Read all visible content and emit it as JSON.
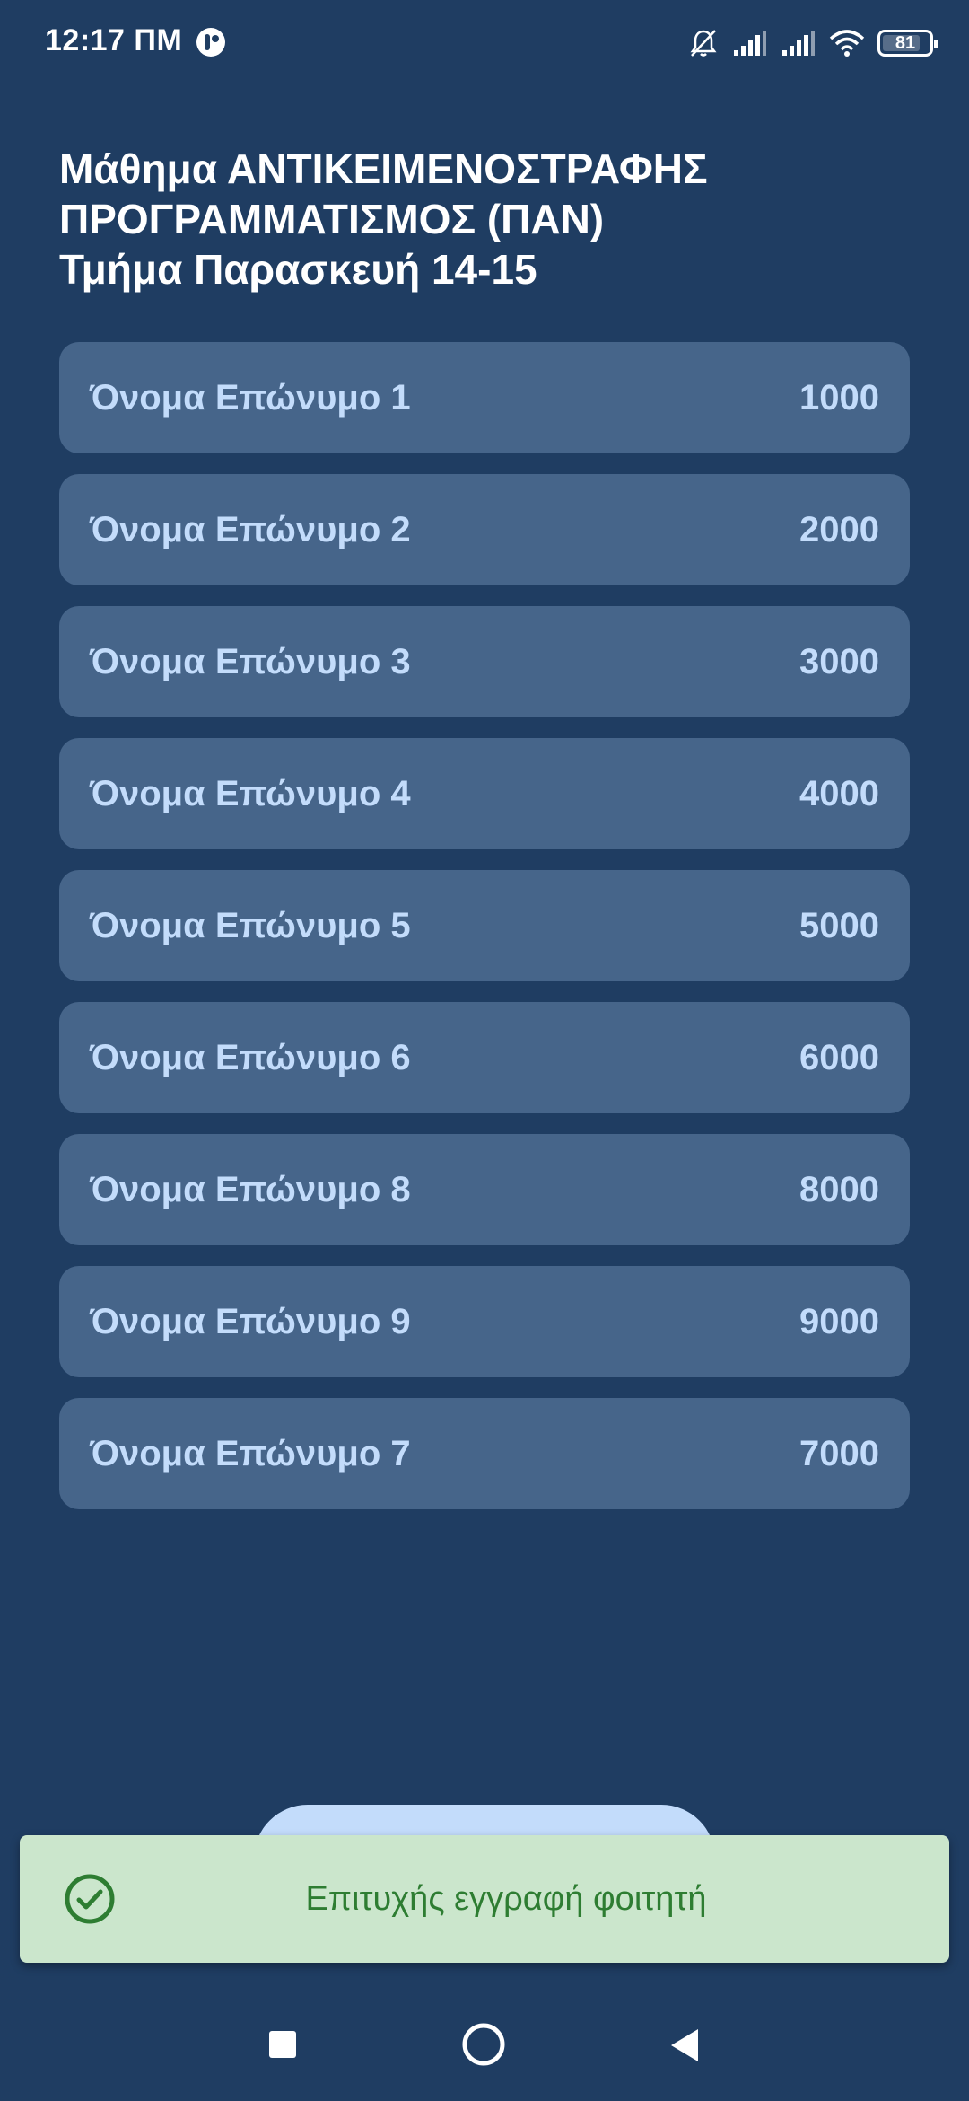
{
  "status_bar": {
    "time": "12:17 ΠΜ",
    "battery": "81",
    "battery_fraction": 0.81
  },
  "header": {
    "title_lines": [
      "Μάθημα ΑΝΤΙΚΕΙΜΕΝΟΣΤΡΑΦΗΣ",
      "ΠΡΟΓΡΑΜΜΑΤΙΣΜΟΣ (ΠΑΝ)",
      "Τμήμα Παρασκευή 14-15"
    ]
  },
  "students": [
    {
      "name": "Όνομα Επώνυμο 1",
      "id": "1000"
    },
    {
      "name": "Όνομα Επώνυμο 2",
      "id": "2000"
    },
    {
      "name": "Όνομα Επώνυμο 3",
      "id": "3000"
    },
    {
      "name": "Όνομα Επώνυμο 4",
      "id": "4000"
    },
    {
      "name": "Όνομα Επώνυμο 5",
      "id": "5000"
    },
    {
      "name": "Όνομα Επώνυμο 6",
      "id": "6000"
    },
    {
      "name": "Όνομα Επώνυμο 8",
      "id": "8000"
    },
    {
      "name": "Όνομα Επώνυμο 9",
      "id": "9000"
    },
    {
      "name": "Όνομα Επώνυμο 7",
      "id": "7000"
    }
  ],
  "snackbar": {
    "message": "Επιτυχής εγγραφή φοιτητή",
    "icon": "check-circle-icon"
  },
  "colors": {
    "background": "#1f3d62",
    "card": "#46658a",
    "card_text": "#c3dcfb",
    "snackbar_bg": "#cbe6cc",
    "snackbar_text": "#2e7d32"
  }
}
